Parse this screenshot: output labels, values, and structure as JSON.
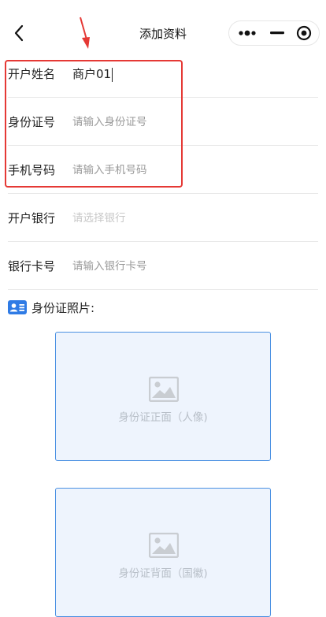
{
  "navbar": {
    "title": "添加资料",
    "back_icon": "chevron-left-icon",
    "more_icon": "more-dots-icon",
    "minimize_icon": "minimize-icon",
    "close_icon": "target-close-icon"
  },
  "form": {
    "name": {
      "label": "开户姓名",
      "value": "商户01"
    },
    "id_number": {
      "label": "身份证号",
      "placeholder": "请输入身份证号"
    },
    "phone": {
      "label": "手机号码",
      "placeholder": "请输入手机号码"
    },
    "bank": {
      "label": "开户银行",
      "placeholder": "请选择银行"
    },
    "card_number": {
      "label": "银行卡号",
      "placeholder": "请输入银行卡号"
    }
  },
  "photos": {
    "title": "身份证照片:",
    "icon": "id-card-icon",
    "front_label": "身份证正面（人像)",
    "back_label": "身份证背面（国徽)"
  },
  "colors": {
    "highlight": "#e53935",
    "upload_bg": "#eef4fd",
    "upload_border": "#4a90e2",
    "icon_blue": "#2f7be5"
  }
}
